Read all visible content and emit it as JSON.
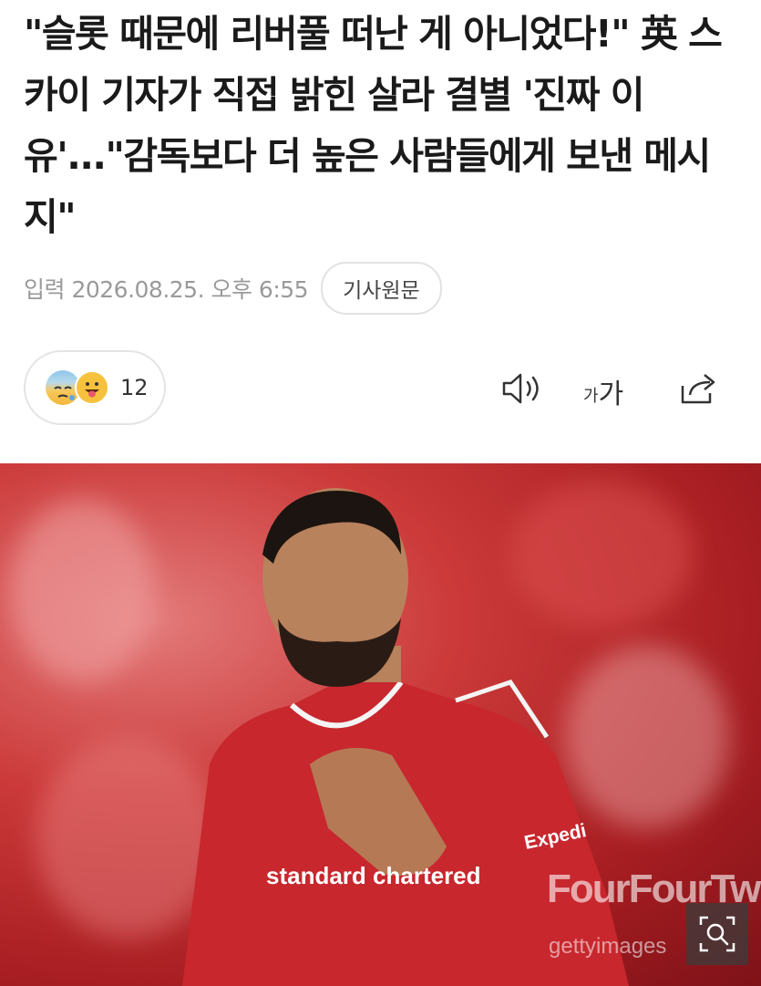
{
  "article": {
    "headline": "\"슬롯 때문에 리버풀 떠난 게 아니었다!\" 英 스카이 기자가 직접 밝힌 살라 결별 '진짜 이유'...\"감독보다 더 높은 사람들에게 보낸 메시지\"",
    "date_label": "입력 2026.08.25. 오후 6:55",
    "source_button": "기사원문"
  },
  "reactions": {
    "count": "12",
    "icons": [
      "sad-sweat-emoji",
      "tongue-out-emoji"
    ]
  },
  "toolbar": {
    "audio_icon": "speaker-icon",
    "font_small": "가",
    "font_large": "가",
    "share_icon": "share-icon"
  },
  "photo": {
    "alt_subject": "player in red jersey with hand on chest",
    "jersey_sponsor": "standard chartered",
    "jersey_sleeve": "Expedi",
    "watermark_main": "FourFourTwo",
    "watermark_sub": "gettyimages",
    "zoom_icon": "zoom-icon"
  }
}
